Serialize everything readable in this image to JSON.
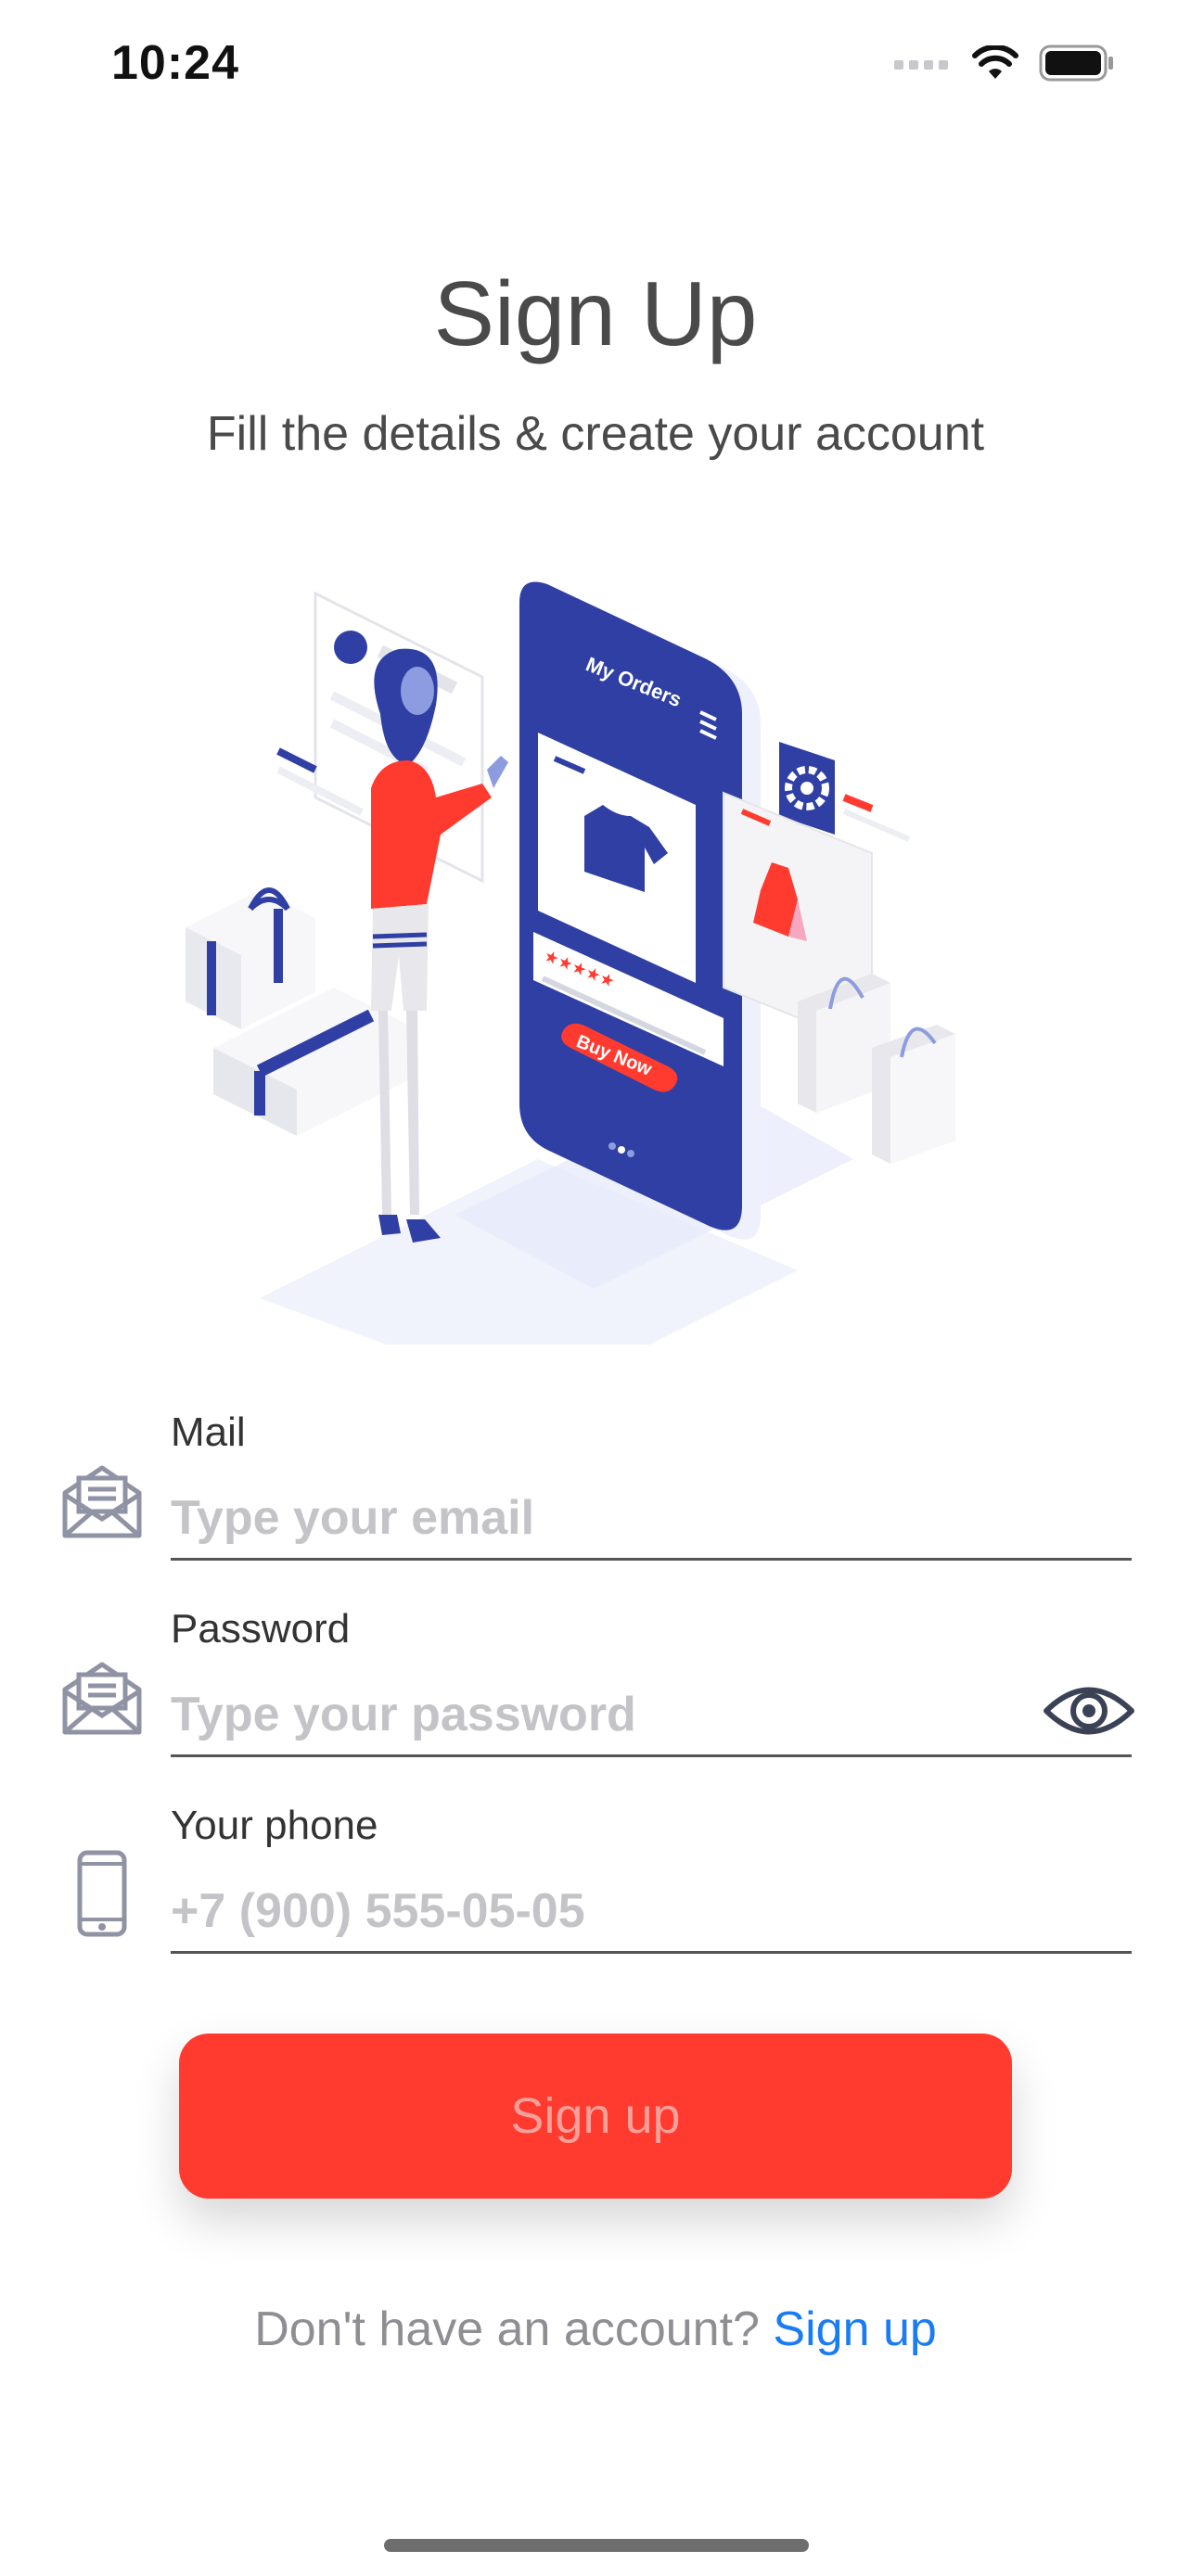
{
  "status_bar": {
    "time": "10:24",
    "icons": [
      "signal-icon",
      "wifi-icon",
      "battery-icon"
    ]
  },
  "header": {
    "title": "Sign Up",
    "subtitle": "Fill the details & create your account"
  },
  "illustration": {
    "screen_title": "My Orders",
    "button_label": "Buy Now"
  },
  "form": {
    "mail": {
      "label": "Mail",
      "placeholder": "Type your email",
      "value": "",
      "icon": "mail-icon"
    },
    "password": {
      "label": "Password",
      "placeholder": "Type your password",
      "value": "",
      "icon": "mail-icon",
      "toggle_icon": "eye-icon"
    },
    "phone": {
      "label": "Your phone",
      "placeholder": "+7 (900) 555-05-05",
      "value": "",
      "icon": "phone-icon"
    }
  },
  "signup_button": {
    "label": "Sign up"
  },
  "footer": {
    "prompt": "Don't have an account?",
    "link": "Sign up"
  },
  "colors": {
    "accent": "#ff3b30",
    "link": "#1a7cf2",
    "illustration_blue": "#2f3fa3"
  }
}
